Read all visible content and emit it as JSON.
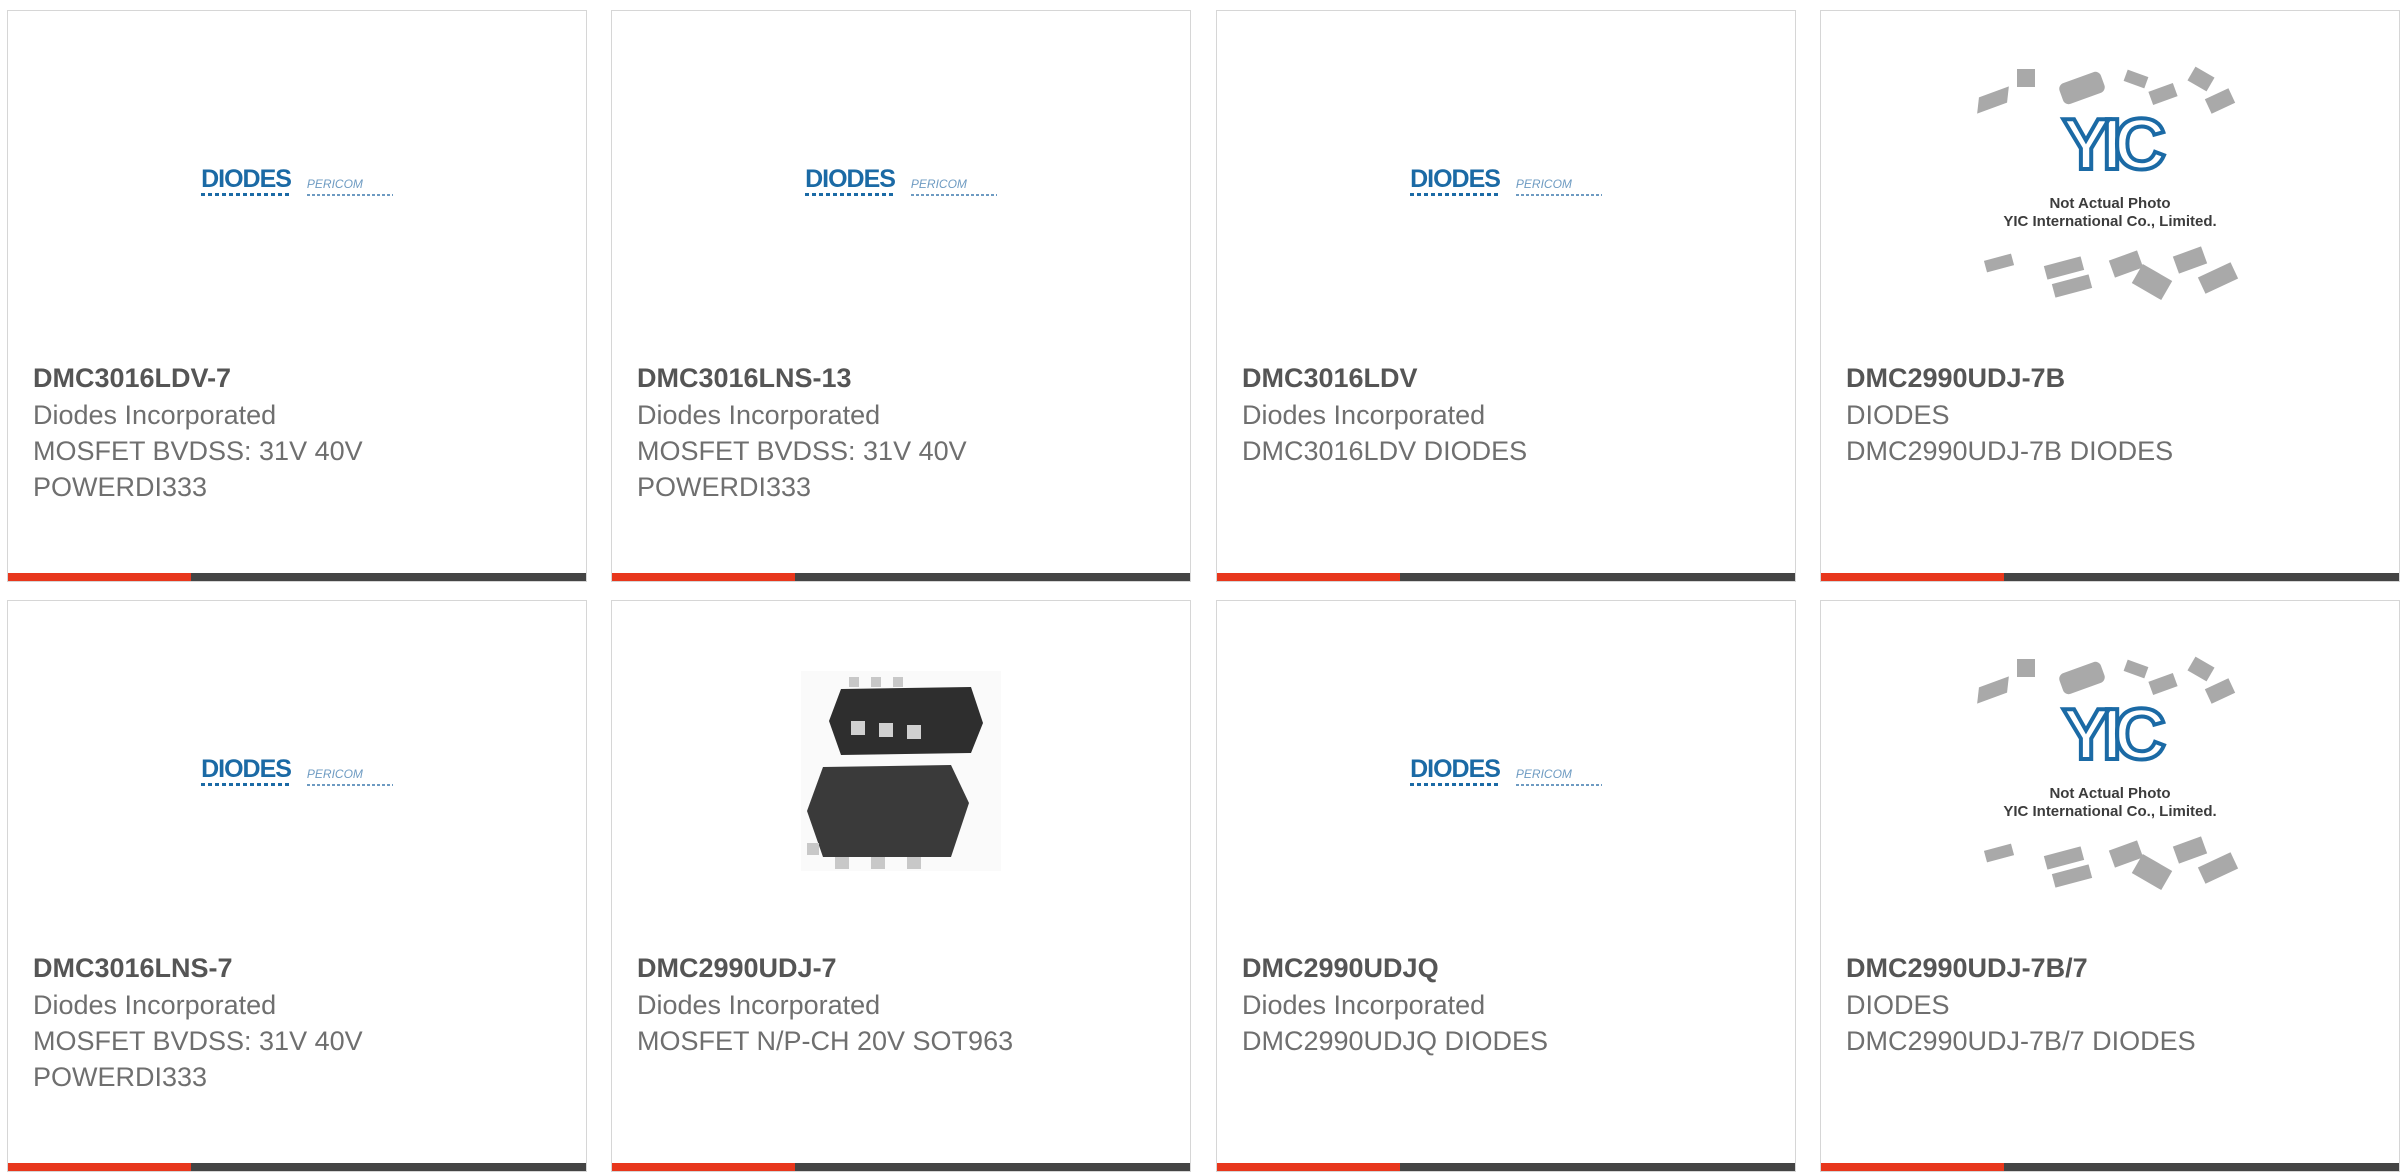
{
  "colors": {
    "accent_red": "#e8371c",
    "bar_dark": "#444444",
    "diodes_blue": "#1b6aa5",
    "pericom_blue": "#6e9bc2",
    "yic_blue": "#1b6aa5"
  },
  "logos": {
    "diodes": "DIODES",
    "pericom": "PERICOM",
    "yic_mark": "YIC",
    "yic_line1": "Not Actual Photo",
    "yic_line2": "YIC International Co., Limited."
  },
  "products": [
    {
      "part": "DMC3016LDV-7",
      "maker": "Diodes Incorporated",
      "desc": "MOSFET BVDSS: 31V 40V",
      "desc2": "POWERDI333",
      "image": "diodes-logo"
    },
    {
      "part": "DMC3016LNS-13",
      "maker": "Diodes Incorporated",
      "desc": "MOSFET BVDSS: 31V 40V",
      "desc2": "POWERDI333",
      "image": "diodes-logo"
    },
    {
      "part": "DMC3016LDV",
      "maker": "Diodes Incorporated",
      "desc": "DMC3016LDV DIODES",
      "desc2": "",
      "image": "diodes-logo"
    },
    {
      "part": "DMC2990UDJ-7B",
      "maker": "DIODES",
      "desc": "DMC2990UDJ-7B DIODES",
      "desc2": "",
      "image": "yic-not-actual-photo"
    },
    {
      "part": "DMC3016LNS-7",
      "maker": "Diodes Incorporated",
      "desc": "MOSFET BVDSS: 31V 40V",
      "desc2": "POWERDI333",
      "image": "diodes-logo"
    },
    {
      "part": "DMC2990UDJ-7",
      "maker": "Diodes Incorporated",
      "desc": "MOSFET N/P-CH 20V SOT963",
      "desc2": "",
      "image": "package-photo"
    },
    {
      "part": "DMC2990UDJQ",
      "maker": "Diodes Incorporated",
      "desc": "DMC2990UDJQ DIODES",
      "desc2": "",
      "image": "diodes-logo"
    },
    {
      "part": "DMC2990UDJ-7B/7",
      "maker": "DIODES",
      "desc": "DMC2990UDJ-7B/7 DIODES",
      "desc2": "",
      "image": "yic-not-actual-photo"
    }
  ]
}
